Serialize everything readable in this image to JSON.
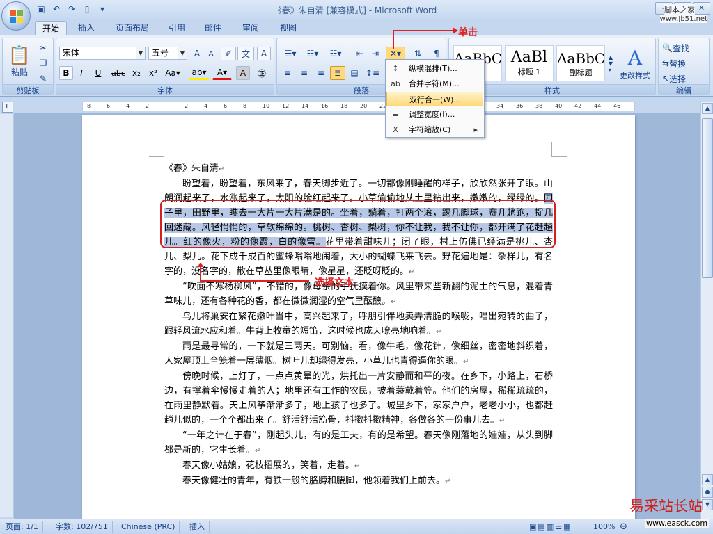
{
  "window": {
    "title": "《春》朱自清 [兼容模式] - Microsoft Word"
  },
  "watermark": {
    "top_name": "脚本之家",
    "top_url": "www.Jb51.net",
    "bottom_name": "易采站长站",
    "bottom_url": "www.easck.com"
  },
  "tabs": [
    "开始",
    "插入",
    "页面布局",
    "引用",
    "邮件",
    "审阅",
    "视图"
  ],
  "ribbon": {
    "clipboard": {
      "label": "剪贴板",
      "paste": "粘贴"
    },
    "font": {
      "label": "字体",
      "name": "宋体",
      "size": "五号"
    },
    "paragraph": {
      "label": "段落"
    },
    "styles": {
      "label": "样式",
      "tiles": [
        {
          "sample": "AaBbC",
          "name": ""
        },
        {
          "sample": "AaBl",
          "name": "标题 1"
        },
        {
          "sample": "AaBbC",
          "name": "副标题"
        }
      ],
      "change_styles": "更改样式"
    },
    "editing": {
      "label": "编辑",
      "find": "查找",
      "replace": "替换",
      "select": "选择"
    }
  },
  "menu": {
    "items": [
      {
        "label": "纵横混排(T)...",
        "icon": "↕"
      },
      {
        "label": "合并字符(M)...",
        "icon": "ab"
      },
      {
        "label": "双行合一(W)...",
        "icon": ""
      },
      {
        "label": "调整宽度(I)...",
        "icon": "≡"
      },
      {
        "label": "字符缩放(C)",
        "icon": "X"
      }
    ]
  },
  "annotations": {
    "click": "单击",
    "select": "选择文本"
  },
  "ruler": {
    "h_ticks": [
      "8",
      "6",
      "4",
      "2",
      "",
      "2",
      "4",
      "6",
      "8",
      "10",
      "12",
      "14",
      "16",
      "18",
      "20",
      "22",
      "24",
      "26",
      "28",
      "30",
      "32",
      "34",
      "36",
      "38",
      "40",
      "42",
      "44",
      "46"
    ]
  },
  "document": {
    "title": "《春》朱自清",
    "p1_before": "盼望着，盼望着，东风来了，春天脚步近了。一切都像刚睡醒的样子，欣欣然张开了眼。山朗润起来了，水涨起来了，太阳的脸红起来了。小草偷偷地从土里钻出来，嫩嫩的，绿绿的。",
    "p1_selected": "园子里，田野里，瞧去一大片一大片满是的。坐着，躺着，打两个滚，踢几脚球，赛几趟跑，捉几回迷藏。风轻悄悄的，草软绵绵的。桃树、杏树、梨树，你不让我，我不让你，都开满了花赶趟儿。红的像火，粉的像霞，白的像雪。",
    "p1_after": "花里带着甜味儿；闭了眼，村上仿佛已经满是桃儿、杏儿、梨儿。花下成千成百的蜜蜂嗡嗡地闹着，大小的蝴蝶飞来飞去。野花遍地是：杂样儿，有名字的，没名字的，散在草丛里像眼睛，像星星，还眨呀眨的。",
    "p2": "“吹面不寒杨柳风”，不错的，像母亲的手抚摸着你。风里带来些新翻的泥土的气息，混着青草味儿，还有各种花的香，都在微微润湿的空气里酝酿。",
    "p3": "鸟儿将巢安在繁花嫩叶当中，高兴起来了，呼朋引伴地卖弄清脆的喉咙，唱出宛转的曲子，跟轻风流水应和着。牛背上牧童的短笛，这时候也成天嘹亮地响着。",
    "p4": "雨是最寻常的，一下就是三两天。可别恼。看，像牛毛，像花针，像细丝，密密地斜织着，人家屋顶上全笼着一层薄烟。树叶儿却绿得发亮，小草儿也青得逼你的眼。",
    "p5": "傍晚时候，上灯了，一点点黄晕的光，烘托出一片安静而和平的夜。在乡下，小路上，石桥边，有撑着伞慢慢走着的人；地里还有工作的农民，披着蓑戴着笠。他们的房屋，稀稀疏疏的，在雨里静默着。天上风筝渐渐多了，地上孩子也多了。城里乡下，家家户户，老老小小，也都赶趟儿似的，一个个都出来了。舒活舒活筋骨，抖擞抖擞精神，各做各的一份事儿去。",
    "p6": "“一年之计在于春”，刚起头儿，有的是工夫，有的是希望。春天像刚落地的娃娃，从头到脚都是新的，它生长着。",
    "p7": "春天像小姑娘，花枝招展的，笑着，走着。",
    "p8": "春天像健壮的青年，有铁一般的胳膊和腰脚，他领着我们上前去。"
  },
  "status": {
    "page": "页面: 1/1",
    "words": "字数: 102/751",
    "language": "Chinese (PRC)",
    "mode": "插入",
    "zoom": "100%"
  }
}
